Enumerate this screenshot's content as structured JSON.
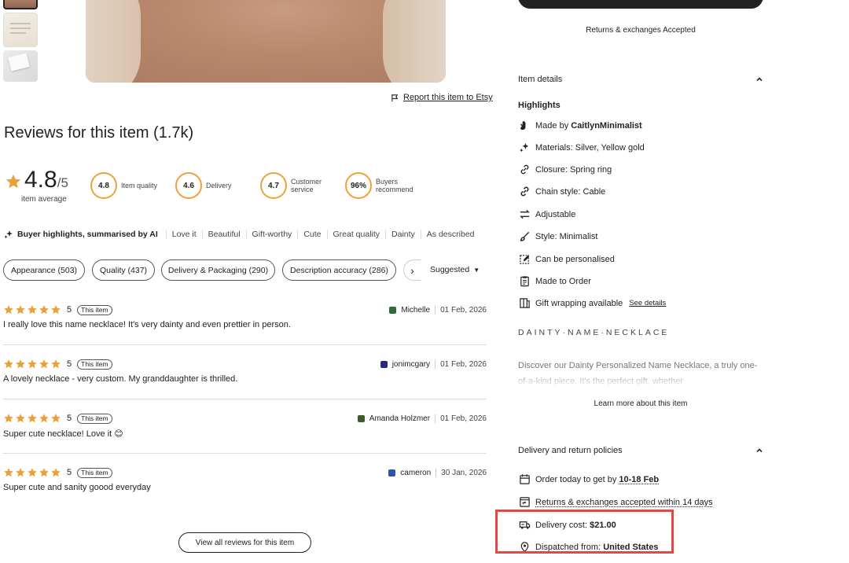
{
  "report_link": "Report this item to Etsy",
  "reviews": {
    "title": "Reviews for this item (1.7k)",
    "rating": "4.8",
    "rating_max": "/5",
    "rating_caption": "item average",
    "scores": [
      {
        "value": "4.8",
        "label": "Item quality"
      },
      {
        "value": "4.6",
        "label": "Delivery"
      },
      {
        "value": "4.7",
        "label_line1": "Customer",
        "label_line2": "service"
      },
      {
        "value": "96%",
        "label_line1": "Buyers",
        "label_line2": "recommend"
      }
    ],
    "buyer_highlights_title": "Buyer highlights, summarised by AI",
    "highlight_tags": [
      "Love it",
      "Beautiful",
      "Gift-worthy",
      "Cute",
      "Great quality",
      "Dainty",
      "As described"
    ],
    "filters": [
      "Appearance (503)",
      "Quality (437)",
      "Delivery & Packaging (290)",
      "Description accuracy (286)"
    ],
    "sort_label": "Suggested",
    "this_item_badge": "This item",
    "items": [
      {
        "stars": "5",
        "name": "Michelle",
        "date": "01 Feb, 2026",
        "text": "I really love this name necklace! It's very dainty and even prettier in person.",
        "avatar_color": "#2e6b3c"
      },
      {
        "stars": "5",
        "name": "jonimcgary",
        "date": "01 Feb, 2026",
        "text": "A lovely necklace - very custom. My granddaughter is thrilled.",
        "avatar_color": "#2a2a7a"
      },
      {
        "stars": "5",
        "name": "Amanda Holzmer",
        "date": "01 Feb, 2026",
        "text": "Super cute necklace! Love it 😊",
        "avatar_color": "#3f5a2a"
      },
      {
        "stars": "5",
        "name": "cameron",
        "date": "30 Jan, 2026",
        "text": "Super cute and sanity goood everyday",
        "avatar_color": "#2b55a8"
      }
    ],
    "view_all": "View all reviews for this item"
  },
  "right": {
    "returns_label": "Returns & exchanges",
    "returns_value": "Accepted",
    "item_details_title": "Item details",
    "highlights_title": "Highlights",
    "highlights": [
      {
        "icon": "hand-wave-icon",
        "prefix": "Made by ",
        "bold": "CaitlynMinimalist"
      },
      {
        "icon": "sparkle-gem-icon",
        "text": "Materials: Silver, Yellow gold"
      },
      {
        "icon": "link-icon",
        "text": "Closure: Spring ring"
      },
      {
        "icon": "chain-icon",
        "text": "Chain style: Cable"
      },
      {
        "icon": "swap-arrows-icon",
        "text": "Adjustable"
      },
      {
        "icon": "brush-icon",
        "text": "Style: Minimalist"
      },
      {
        "icon": "personalise-icon",
        "text": "Can be personalised"
      },
      {
        "icon": "clipboard-icon",
        "text": "Made to Order"
      },
      {
        "icon": "gift-wrap-icon",
        "text": "Gift wrapping available",
        "link": "See details"
      }
    ],
    "product_heading": "DAINTY·NAME·NECKLACE",
    "description": "Discover our Dainty Personalized Name Necklace, a truly one-of-a-kind piece. It's the perfect gift, whether",
    "learn_more": "Learn more about this item",
    "delivery_title": "Delivery and return policies",
    "delivery": {
      "order_prefix": "Order today to get by ",
      "order_date": "10-18 Feb",
      "returns_text": "Returns & exchanges accepted within 14 days",
      "cost_label": "Delivery cost: ",
      "cost_value": "$21.00",
      "dispatch_label": "Dispatched from: ",
      "dispatch_value": "United States"
    }
  },
  "colors": {
    "star": "#e8a13a",
    "ring": "#f1a039",
    "highlight_box": "#e04a44"
  }
}
